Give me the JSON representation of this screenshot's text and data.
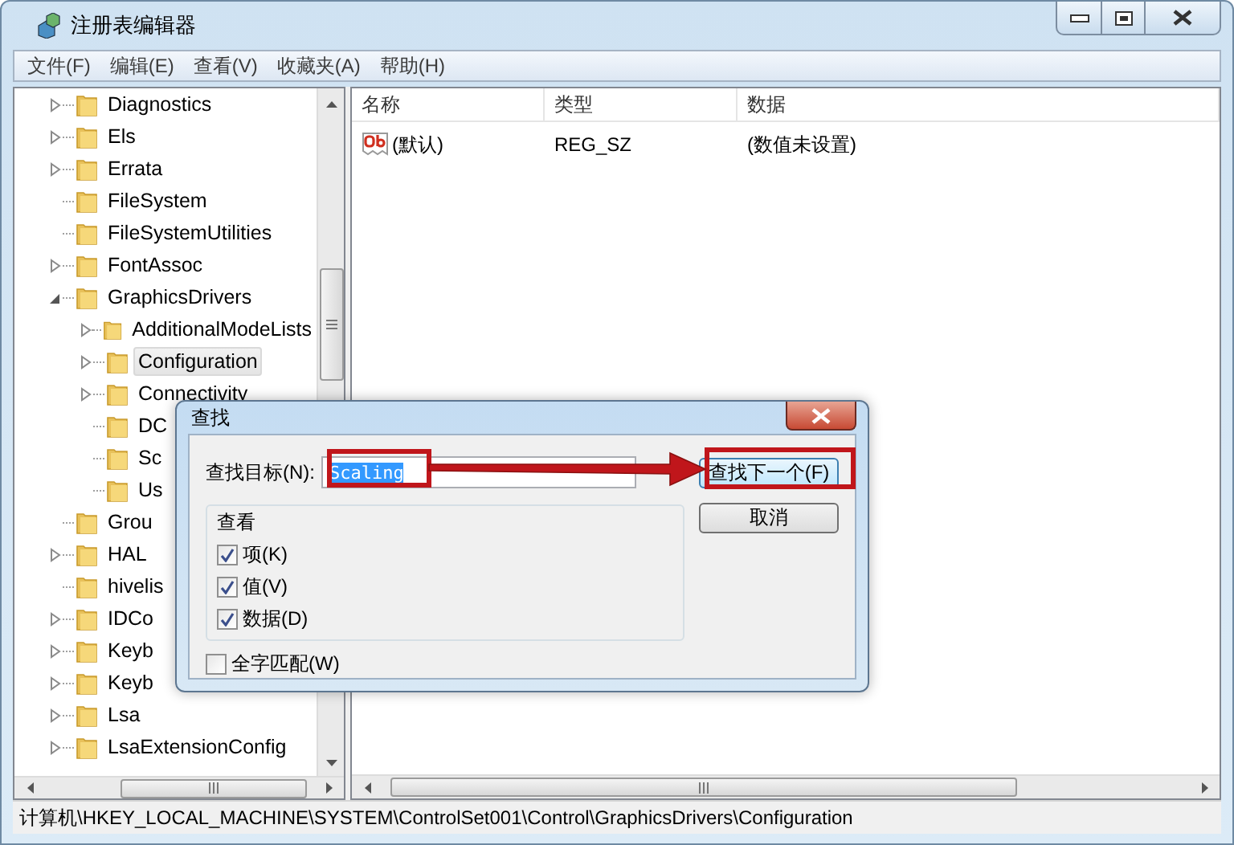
{
  "window": {
    "title": "注册表编辑器"
  },
  "menu": [
    "文件(F)",
    "编辑(E)",
    "查看(V)",
    "收藏夹(A)",
    "帮助(H)"
  ],
  "tree": {
    "items": [
      {
        "label": "Diagnostics",
        "has_children": true,
        "selected": false
      },
      {
        "label": "Els",
        "has_children": true,
        "selected": false
      },
      {
        "label": "Errata",
        "has_children": true,
        "selected": false
      },
      {
        "label": "FileSystem",
        "has_children": false,
        "selected": false
      },
      {
        "label": "FileSystemUtilities",
        "has_children": false,
        "selected": false
      },
      {
        "label": "FontAssoc",
        "has_children": true,
        "selected": false
      },
      {
        "label": "GraphicsDrivers",
        "expanded": true,
        "selected": false,
        "children": [
          {
            "label": "AdditionalModeLists",
            "has_children": true,
            "selected": false
          },
          {
            "label": "Configuration",
            "has_children": true,
            "selected": true
          },
          {
            "label": "Connectivity",
            "has_children": true,
            "selected": false
          },
          {
            "label": "DC",
            "has_children": false,
            "selected": false
          },
          {
            "label": "Sc",
            "has_children": false,
            "selected": false
          },
          {
            "label": "Us",
            "has_children": false,
            "selected": false
          }
        ]
      },
      {
        "label": "Grou",
        "has_children": false,
        "selected": false
      },
      {
        "label": "HAL",
        "has_children": true,
        "selected": false
      },
      {
        "label": "hivelis",
        "has_children": false,
        "selected": false
      },
      {
        "label": "IDCo",
        "has_children": true,
        "selected": false
      },
      {
        "label": "Keyb",
        "has_children": true,
        "selected": false
      },
      {
        "label": "Keyb",
        "has_children": true,
        "selected": false
      },
      {
        "label": "Lsa",
        "has_children": true,
        "selected": false
      },
      {
        "label": "LsaExtensionConfig",
        "has_children": true,
        "selected": false
      }
    ]
  },
  "list": {
    "columns": [
      "名称",
      "类型",
      "数据"
    ],
    "rows": [
      {
        "name": "(默认)",
        "type": "REG_SZ",
        "data": "(数值未设置)"
      }
    ]
  },
  "find_dialog": {
    "title": "查找",
    "target_label": "查找目标(N):",
    "target_value": "Scaling",
    "value_selected": true,
    "buttons": [
      {
        "label": "查找下一个(F)",
        "default": true
      },
      {
        "label": "取消",
        "default": false
      }
    ],
    "look_at": {
      "title": "查看",
      "options": [
        {
          "label": "项(K)",
          "checked": true
        },
        {
          "label": "值(V)",
          "checked": true
        },
        {
          "label": "数据(D)",
          "checked": true
        }
      ]
    },
    "match_whole": {
      "label": "全字匹配(W)",
      "checked": false
    }
  },
  "status_bar": "计算机\\HKEY_LOCAL_MACHINE\\SYSTEM\\ControlSet001\\Control\\GraphicsDrivers\\Configuration"
}
